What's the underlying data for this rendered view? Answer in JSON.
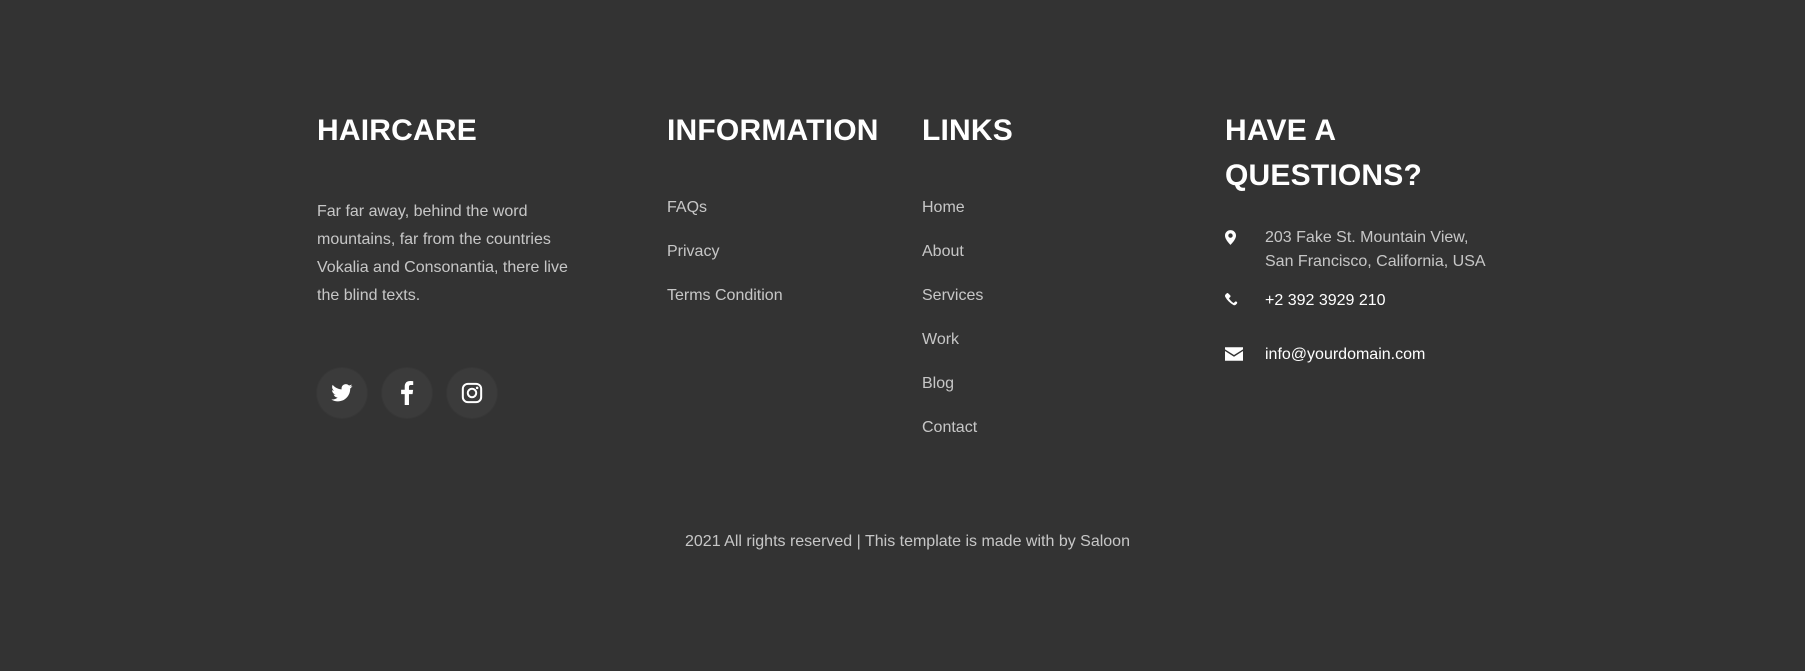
{
  "colors": {
    "background": "#333333",
    "social_button_bg": "#3b3b3b",
    "heading": "#ffffff",
    "body_text": "#c4c4c4"
  },
  "about": {
    "heading": "HAIRCARE",
    "text": "Far far away, behind the word mountains, far from the countries Vokalia and Consonantia, there live the blind texts."
  },
  "socials": [
    {
      "icon": "twitter-icon"
    },
    {
      "icon": "facebook-icon"
    },
    {
      "icon": "instagram-icon"
    }
  ],
  "information": {
    "heading": "INFORMATION",
    "items": [
      "FAQs",
      "Privacy",
      "Terms Condition"
    ]
  },
  "links": {
    "heading": "LINKS",
    "items": [
      "Home",
      "About",
      "Services",
      "Work",
      "Blog",
      "Contact"
    ]
  },
  "contact": {
    "heading_line1": "HAVE A",
    "heading_line2": "QUESTIONS?",
    "address_line1": "203 Fake St. Mountain View,",
    "address_line2": "San Francisco, California, USA",
    "address_icon": "map-marker-icon",
    "phone": "+2 392 3929 210",
    "phone_icon": "phone-icon",
    "email": "info@yourdomain.com",
    "email_icon": "envelope-icon"
  },
  "footer": {
    "copyright": "2021 All rights reserved | This template is made with by Saloon"
  }
}
